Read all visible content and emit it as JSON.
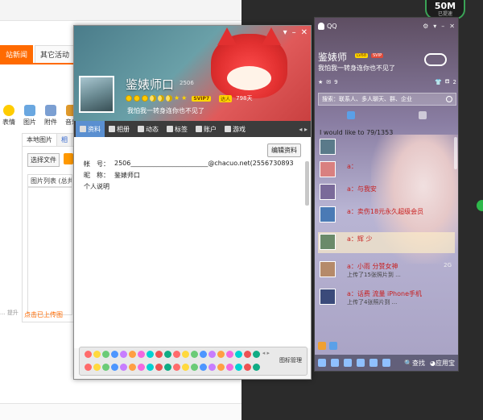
{
  "bg_page": {
    "tabs": [
      "站新闻",
      "其它活动",
      "T"
    ],
    "tools": [
      "表情",
      "图片",
      "附件",
      "音乐"
    ],
    "upload_tabs": [
      "本地图片",
      "相"
    ],
    "choose_file": "选择文件",
    "pic_list": "图片列表 (总共",
    "hint": "... 提升",
    "uploaded_link": "点击已上传图"
  },
  "speed": {
    "value": "50M",
    "label": "已提速"
  },
  "profile": {
    "nickname": "鉴婊师口",
    "level_small": "2506",
    "svip_badge": "SVIP7",
    "talent_badge": "达人",
    "days": "798天",
    "signature": "我怕我一转身连你也不见了",
    "nav": [
      {
        "label": "资料",
        "icon": "profile-icon"
      },
      {
        "label": "相册",
        "icon": "album-icon"
      },
      {
        "label": "动态",
        "icon": "feed-icon"
      },
      {
        "label": "标签",
        "icon": "tag-icon"
      },
      {
        "label": "账户",
        "icon": "account-icon"
      },
      {
        "label": "游戏",
        "icon": "game-icon"
      }
    ],
    "edit_btn": "编辑资料",
    "fields": [
      {
        "key": "帐　号：",
        "value": "2506________________________@chacuo.net(2556730893"
      },
      {
        "key": "昵　称：",
        "value": "鉴婊师口"
      },
      {
        "key": "个人说明",
        "value": ""
      }
    ],
    "emoji_manage": "图标管理"
  },
  "qq": {
    "title": "QQ",
    "nickname": "鉴婊师",
    "vip1": "LV68",
    "vip2": "SVIP",
    "signature": "我怕我一转身连你也不见了",
    "mail_count": "9",
    "right_count": "2",
    "search_placeholder": "搜索：联系人、多人聊天、群、企业",
    "group": "I would like to 79/1353",
    "friends": [
      {
        "name": "",
        "sub": "",
        "right": ""
      },
      {
        "name": "a：",
        "sub": "",
        "right": ""
      },
      {
        "name": "a：与我安",
        "sub": "",
        "right": ""
      },
      {
        "name": "a：卖伤18元永久超级会员",
        "sub": "",
        "right": ""
      },
      {
        "name": "a：辉 少",
        "sub": "",
        "right": ""
      },
      {
        "name": "a：小雨 分赞女神",
        "sub": "上传了15张照片到 ...",
        "right": "2G"
      },
      {
        "name": "a：话费 流量 iPhone手机",
        "sub": "上传了4张照片到 ...",
        "right": ""
      }
    ],
    "toolbar_search": "查找",
    "toolbar_apps": "应用宝"
  }
}
